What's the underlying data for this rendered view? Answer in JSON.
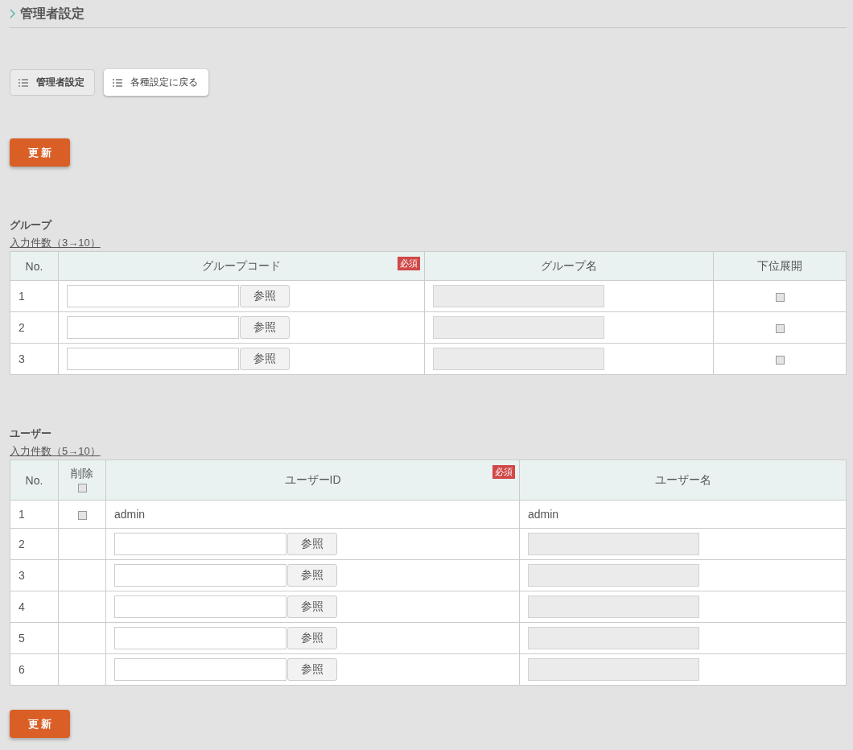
{
  "page_title": "管理者設定",
  "nav_buttons": [
    {
      "label": "管理者設定",
      "selected": true
    },
    {
      "label": "各種設定に戻る",
      "selected": false
    }
  ],
  "top_update_button": "更 新",
  "groups": {
    "title": "グループ",
    "count_link": "入力件数（3→10）",
    "columns": [
      {
        "label": "No."
      },
      {
        "label": "グループコード",
        "required_badge": "必須"
      },
      {
        "label": "グループ名"
      },
      {
        "label": "下位展開"
      }
    ],
    "rows": [
      {
        "no": "1",
        "browse_label": "参照",
        "expand_checked": false
      },
      {
        "no": "2",
        "browse_label": "参照",
        "expand_checked": false
      },
      {
        "no": "3",
        "browse_label": "参照",
        "expand_checked": false
      }
    ]
  },
  "users": {
    "title": "ユーザー",
    "count_link": "入力件数（5→10）",
    "columns": [
      {
        "label": "No."
      },
      {
        "label": "削除",
        "checked": false
      },
      {
        "label": "ユーザーID",
        "required_badge": "必須"
      },
      {
        "label": "ユーザー名"
      }
    ],
    "rows": [
      {
        "no": "1",
        "kind": "fixed",
        "delete_checked": false,
        "user_id": "admin",
        "user_name": "admin"
      },
      {
        "no": "2",
        "kind": "entry",
        "browse_label": "参照"
      },
      {
        "no": "3",
        "kind": "entry",
        "browse_label": "参照"
      },
      {
        "no": "4",
        "kind": "entry",
        "browse_label": "参照"
      },
      {
        "no": "5",
        "kind": "entry",
        "browse_label": "参照"
      },
      {
        "no": "6",
        "kind": "entry",
        "browse_label": "参照"
      }
    ]
  },
  "bottom_update_button": "更 新"
}
